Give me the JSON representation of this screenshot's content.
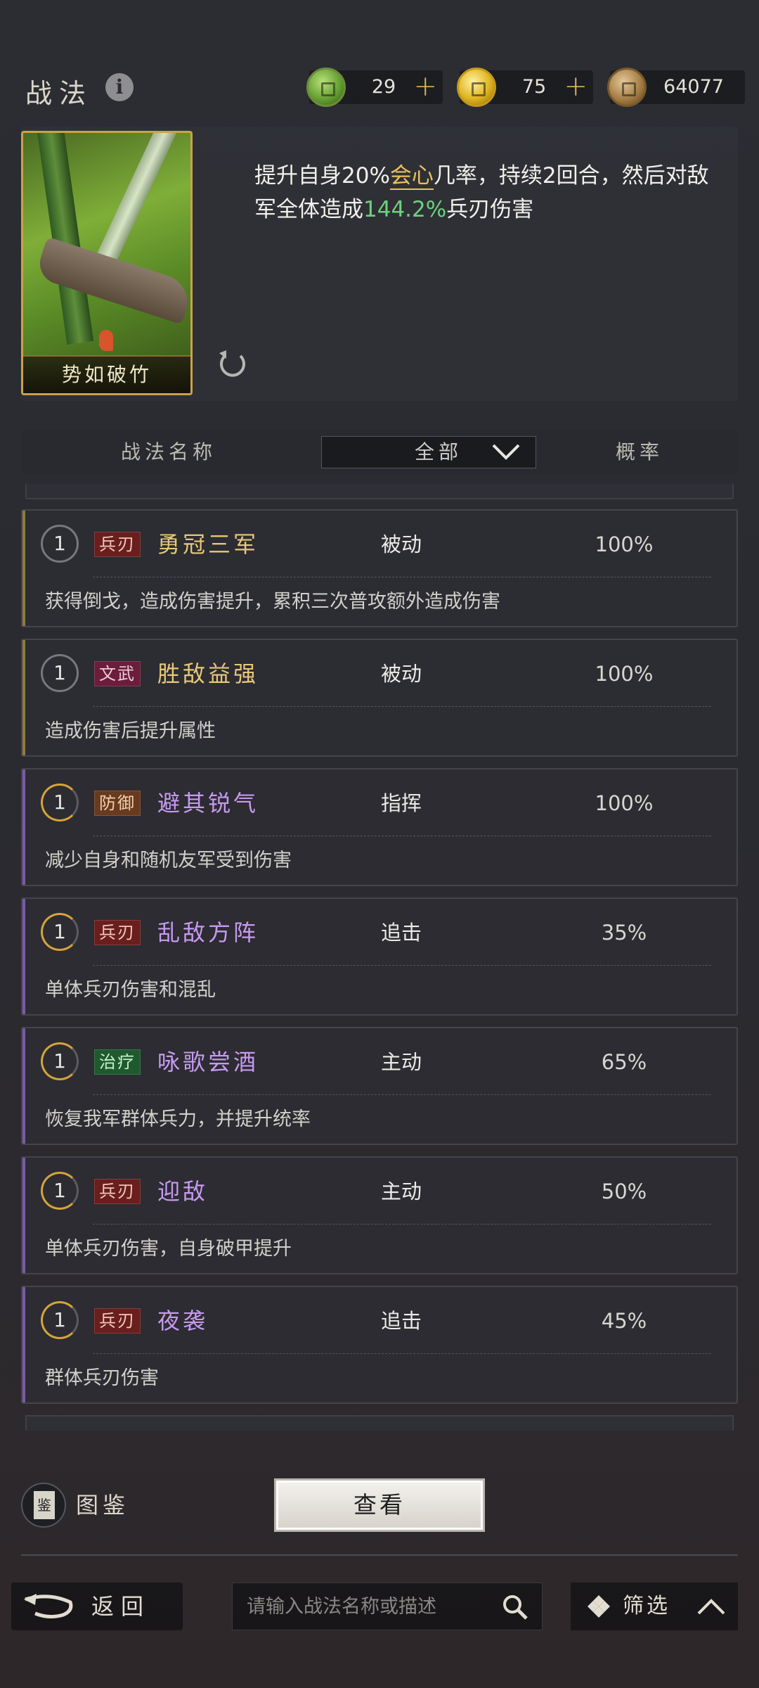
{
  "header": {
    "title": "战法",
    "currencies": [
      {
        "icon": "jade-icon",
        "value": "29",
        "plus": "+"
      },
      {
        "icon": "gold-coin-icon",
        "value": "75",
        "plus": "+"
      },
      {
        "icon": "copper-coin-icon",
        "value": "64077"
      }
    ]
  },
  "skill": {
    "card_name": "势如破竹",
    "desc_part1": "提升自身20%",
    "desc_hl1": "会心",
    "desc_part2": "几率，持续2回合，然后对敌军全体造成",
    "desc_hl2": "144.2%",
    "desc_part3": "兵刃伤害"
  },
  "list_header": {
    "name_col": "战法名称",
    "filter_value": "全部",
    "rate_col": "概率"
  },
  "rows": [
    {
      "level": "1",
      "tag": "兵刃",
      "name": "勇冠三军",
      "type": "被动",
      "rate": "100%",
      "desc": "获得倒戈，造成伤害提升，累积三次普攻额外造成伤害"
    },
    {
      "level": "1",
      "tag": "文武",
      "name": "胜敌益强",
      "type": "被动",
      "rate": "100%",
      "desc": "造成伤害后提升属性"
    },
    {
      "level": "1",
      "tag": "防御",
      "name": "避其锐气",
      "type": "指挥",
      "rate": "100%",
      "desc": "减少自身和随机友军受到伤害"
    },
    {
      "level": "1",
      "tag": "兵刃",
      "name": "乱敌方阵",
      "type": "追击",
      "rate": "35%",
      "desc": "单体兵刃伤害和混乱"
    },
    {
      "level": "1",
      "tag": "治疗",
      "name": "咏歌尝酒",
      "type": "主动",
      "rate": "65%",
      "desc": "恢复我军群体兵力，并提升统率"
    },
    {
      "level": "1",
      "tag": "兵刃",
      "name": "迎敌",
      "type": "主动",
      "rate": "50%",
      "desc": "单体兵刃伤害，自身破甲提升"
    },
    {
      "level": "1",
      "tag": "兵刃",
      "name": "夜袭",
      "type": "追击",
      "rate": "45%",
      "desc": "群体兵刃伤害"
    }
  ],
  "bottom": {
    "atlas_label": "图鉴",
    "view_button": "查看",
    "back_label": "返回",
    "search_placeholder": "请输入战法名称或描述",
    "filter_label": "筛选"
  },
  "colors": {
    "gold_accent": "#e8c060",
    "green_value": "#6ed27a",
    "purple_name": "#c79af0",
    "gold_name": "#e8c878"
  }
}
